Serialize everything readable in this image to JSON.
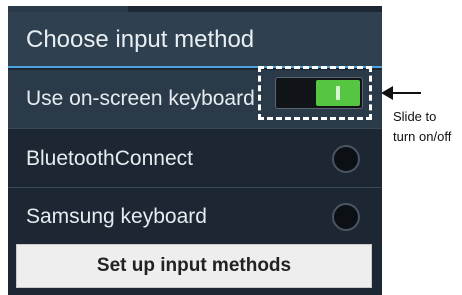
{
  "dialog": {
    "title": "Choose input method",
    "items": [
      {
        "label": "Use on-screen keyboard",
        "control": "toggle",
        "on": true
      },
      {
        "label": "BluetoothConnect",
        "control": "radio",
        "selected": false
      },
      {
        "label": "Samsung keyboard",
        "control": "radio",
        "selected": false
      }
    ],
    "setup_button_label": "Set up input methods"
  },
  "annotation": {
    "line1": "Slide to",
    "line2": "turn on/off"
  },
  "colors": {
    "title_bar": "#2f4050",
    "accent": "#4aa3dc",
    "toggle_on": "#56c542",
    "list_bg": "#1c2733"
  }
}
